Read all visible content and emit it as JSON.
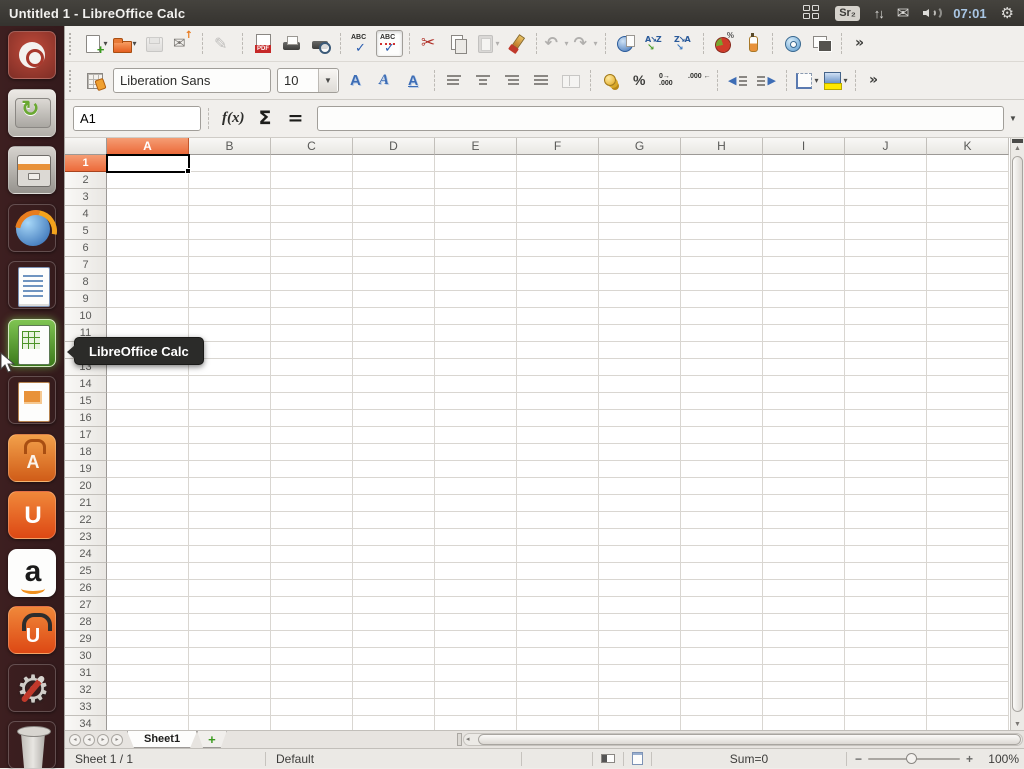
{
  "panel": {
    "title": "Untitled 1 - LibreOffice Calc",
    "keyboard_layout": "Sr₂",
    "clock": "07:01"
  },
  "launcher": {
    "tooltip": "LibreOffice Calc",
    "items": [
      {
        "name": "dash-home"
      },
      {
        "name": "software-updater"
      },
      {
        "name": "files"
      },
      {
        "name": "firefox"
      },
      {
        "name": "libreoffice-writer"
      },
      {
        "name": "libreoffice-calc",
        "active": true
      },
      {
        "name": "libreoffice-impress"
      },
      {
        "name": "software-center"
      },
      {
        "name": "ubuntu-one"
      },
      {
        "name": "amazon"
      },
      {
        "name": "ubuntu-one-music"
      },
      {
        "name": "system-settings"
      },
      {
        "name": "trash"
      }
    ]
  },
  "toolbar_standard": {
    "items": [
      {
        "type": "button",
        "name": "new-document",
        "dropdown": true
      },
      {
        "type": "button",
        "name": "open",
        "dropdown": true
      },
      {
        "type": "button",
        "name": "save",
        "disabled": true
      },
      {
        "type": "button",
        "name": "email-document"
      },
      {
        "type": "sep"
      },
      {
        "type": "button",
        "name": "edit-mode",
        "disabled": true
      },
      {
        "type": "sep"
      },
      {
        "type": "button",
        "name": "export-pdf"
      },
      {
        "type": "button",
        "name": "print"
      },
      {
        "type": "button",
        "name": "page-preview"
      },
      {
        "type": "sep"
      },
      {
        "type": "button",
        "name": "spellcheck"
      },
      {
        "type": "button",
        "name": "auto-spellcheck",
        "pressed": true
      },
      {
        "type": "sep"
      },
      {
        "type": "button",
        "name": "cut"
      },
      {
        "type": "button",
        "name": "copy"
      },
      {
        "type": "button",
        "name": "paste",
        "disabled": true,
        "dropdown": true
      },
      {
        "type": "button",
        "name": "clone-formatting"
      },
      {
        "type": "sep"
      },
      {
        "type": "button",
        "name": "undo",
        "disabled": true,
        "dropdown": true
      },
      {
        "type": "button",
        "name": "redo",
        "disabled": true,
        "dropdown": true
      },
      {
        "type": "sep"
      },
      {
        "type": "button",
        "name": "hyperlink"
      },
      {
        "type": "button",
        "name": "sort-ascending"
      },
      {
        "type": "button",
        "name": "sort-descending"
      },
      {
        "type": "sep"
      },
      {
        "type": "button",
        "name": "insert-chart"
      },
      {
        "type": "button",
        "name": "show-draw-functions"
      },
      {
        "type": "sep"
      },
      {
        "type": "button",
        "name": "navigator"
      },
      {
        "type": "button",
        "name": "gallery"
      },
      {
        "type": "sep"
      },
      {
        "type": "button",
        "name": "toolbar-more"
      }
    ]
  },
  "toolbar_formatting": {
    "font_name": "Liberation Sans",
    "font_size": "10",
    "lead_items": [
      {
        "type": "button",
        "name": "styles-window"
      }
    ],
    "items": [
      {
        "type": "button",
        "name": "bold"
      },
      {
        "type": "button",
        "name": "italic"
      },
      {
        "type": "button",
        "name": "underline"
      },
      {
        "type": "sep"
      },
      {
        "type": "button",
        "name": "align-left"
      },
      {
        "type": "button",
        "name": "align-center"
      },
      {
        "type": "button",
        "name": "align-right"
      },
      {
        "type": "button",
        "name": "align-justify"
      },
      {
        "type": "button",
        "name": "merge-cells",
        "disabled": true
      },
      {
        "type": "sep"
      },
      {
        "type": "button",
        "name": "currency"
      },
      {
        "type": "button",
        "name": "percent"
      },
      {
        "type": "button",
        "name": "add-decimal"
      },
      {
        "type": "button",
        "name": "delete-decimal"
      },
      {
        "type": "sep"
      },
      {
        "type": "button",
        "name": "decrease-indent"
      },
      {
        "type": "button",
        "name": "increase-indent"
      },
      {
        "type": "sep"
      },
      {
        "type": "button",
        "name": "borders",
        "dropdown": true
      },
      {
        "type": "button",
        "name": "background-color",
        "dropdown": true
      },
      {
        "type": "sep"
      },
      {
        "type": "button",
        "name": "toolbar-more"
      }
    ]
  },
  "formula_bar": {
    "cell_reference": "A1",
    "function_wizard_label": "f(x)",
    "sum_label": "Σ",
    "equals_label": "=",
    "input_value": ""
  },
  "grid": {
    "columns": [
      "A",
      "B",
      "C",
      "D",
      "E",
      "F",
      "G",
      "H",
      "I",
      "J",
      "K"
    ],
    "rows": [
      1,
      2,
      3,
      4,
      5,
      6,
      7,
      8,
      9,
      10,
      11,
      12,
      13,
      14,
      15,
      16,
      17,
      18,
      19,
      20,
      21,
      22,
      23,
      24,
      25,
      26,
      27,
      28,
      29,
      30,
      31,
      32,
      33,
      34
    ],
    "selected_column": "A",
    "selected_row": 1,
    "selected_cell": "A1"
  },
  "sheet_bar": {
    "tabs": [
      {
        "label": "Sheet1",
        "active": true
      }
    ],
    "add_tab_label": "+"
  },
  "status_bar": {
    "sheet_position": "Sheet 1 / 1",
    "page_style": "Default",
    "selection_sum": "Sum=0",
    "zoom_level": "100%"
  },
  "colors": {
    "selection_orange": "#ec6a3a",
    "panel_dark": "#3c3a36",
    "launcher_maroon": "#381b1d",
    "calc_highlight_green": "#4c9428"
  }
}
